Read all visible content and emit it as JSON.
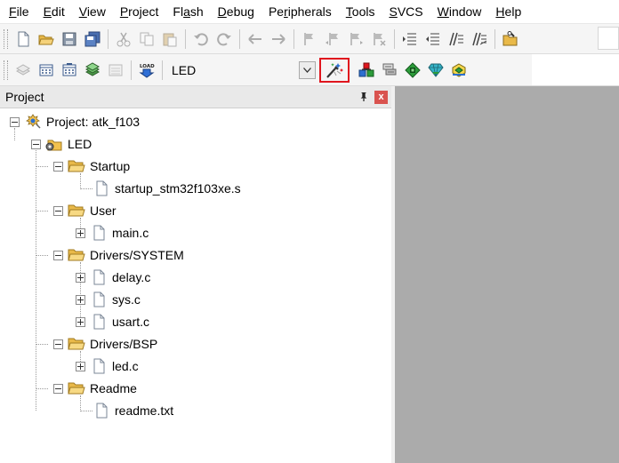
{
  "menu": [
    {
      "mn": "F",
      "rest": "ile"
    },
    {
      "mn": "E",
      "rest": "dit"
    },
    {
      "mn": "V",
      "rest": "iew"
    },
    {
      "mn": "P",
      "rest": "roject"
    },
    {
      "pre": "Fl",
      "mn": "a",
      "rest": "sh"
    },
    {
      "mn": "D",
      "rest": "ebug"
    },
    {
      "pre": "Pe",
      "mn": "r",
      "rest": "ipherals"
    },
    {
      "mn": "T",
      "rest": "ools"
    },
    {
      "mn": "S",
      "rest": "VCS"
    },
    {
      "mn": "W",
      "rest": "indow"
    },
    {
      "mn": "H",
      "rest": "elp"
    }
  ],
  "toolbar2": {
    "target_name": "LED"
  },
  "panel": {
    "title": "Project",
    "close_glyph": "x"
  },
  "tree": {
    "project": "Project: atk_f103",
    "target": "LED",
    "groups": [
      {
        "name": "Startup",
        "files": [
          {
            "name": "startup_stm32f103xe.s",
            "expandable": false
          }
        ]
      },
      {
        "name": "User",
        "files": [
          {
            "name": "main.c",
            "expandable": true
          }
        ]
      },
      {
        "name": "Drivers/SYSTEM",
        "files": [
          {
            "name": "delay.c",
            "expandable": true
          },
          {
            "name": "sys.c",
            "expandable": true
          },
          {
            "name": "usart.c",
            "expandable": true
          }
        ]
      },
      {
        "name": "Drivers/BSP",
        "files": [
          {
            "name": "led.c",
            "expandable": true
          }
        ]
      },
      {
        "name": "Readme",
        "files": [
          {
            "name": "readme.txt",
            "expandable": false
          }
        ]
      }
    ]
  },
  "colors": {
    "highlight_border": "#e0161e",
    "editor_background": "#ababab",
    "folder": "#f2c14e"
  }
}
